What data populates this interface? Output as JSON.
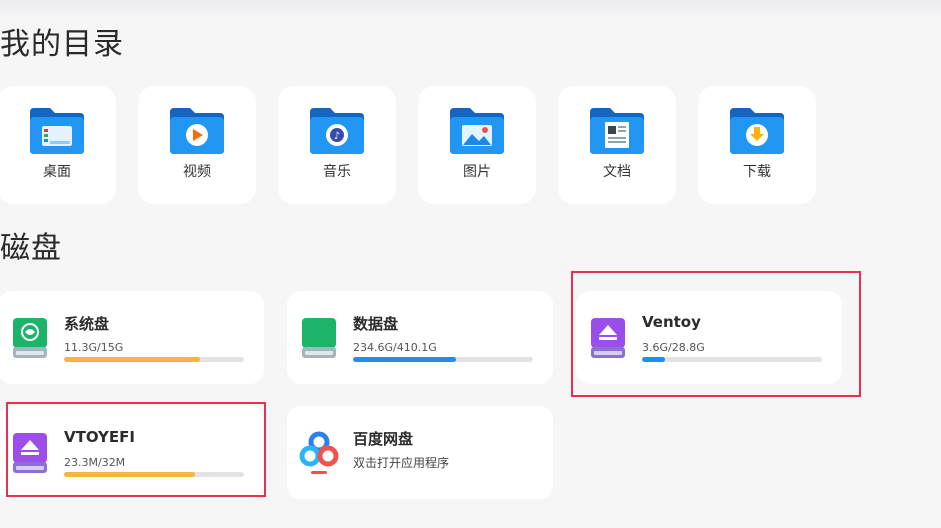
{
  "sections": {
    "my_directory": "我的目录",
    "disks": "磁盘"
  },
  "folders": [
    {
      "label": "桌面",
      "icon": "desktop-folder-icon"
    },
    {
      "label": "视频",
      "icon": "video-folder-icon"
    },
    {
      "label": "音乐",
      "icon": "music-folder-icon"
    },
    {
      "label": "图片",
      "icon": "pictures-folder-icon"
    },
    {
      "label": "文档",
      "icon": "documents-folder-icon"
    },
    {
      "label": "下载",
      "icon": "downloads-folder-icon"
    }
  ],
  "disks": [
    {
      "name": "系统盘",
      "size": "11.3G/15G",
      "usage": 0.753,
      "bar_color": "#f5b541",
      "icon": "system-disk-icon"
    },
    {
      "name": "数据盘",
      "size": "234.6G/410.1G",
      "usage": 0.572,
      "bar_color": "#1f8ef0",
      "icon": "data-disk-icon"
    },
    {
      "name": "Ventoy",
      "size": "3.6G/28.8G",
      "usage": 0.125,
      "bar_color": "#1f8ef0",
      "icon": "removable-disk-icon"
    },
    {
      "name": "VTOYEFI",
      "size": "23.3M/32M",
      "usage": 0.728,
      "bar_color": "#f5b541",
      "icon": "removable-disk-icon"
    }
  ],
  "baidu": {
    "name": "百度网盘",
    "subtitle": "双击打开应用程序",
    "icon": "baidu-netdisk-icon"
  },
  "colors": {
    "highlight": "#e8314f",
    "folder_blue": "#1e88e5"
  }
}
